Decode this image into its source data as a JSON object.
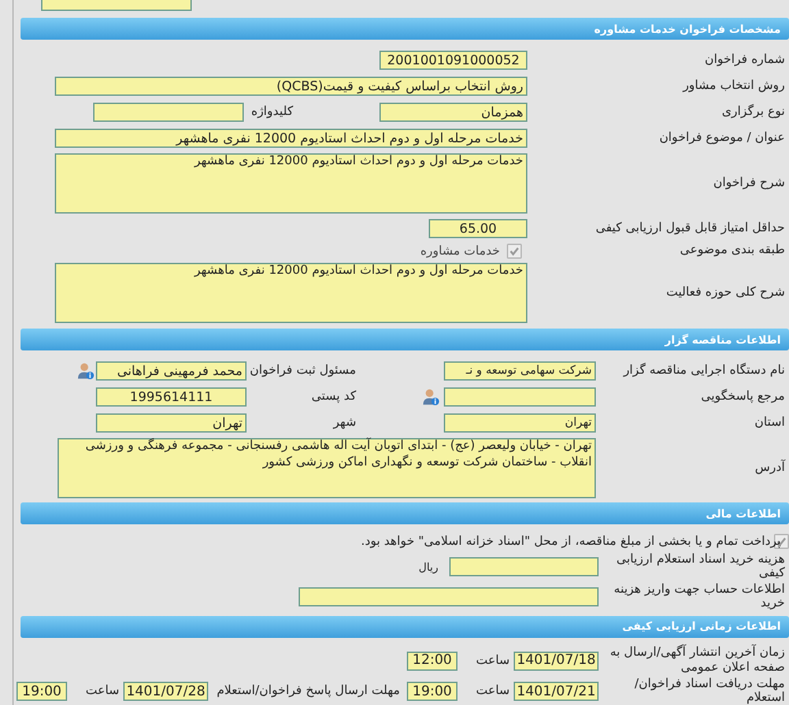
{
  "call_section": {
    "title": "مشخصات فراخوان خدمات مشاوره",
    "call_number": {
      "label": "شماره فراخوان",
      "value": "2001001091000052"
    },
    "selection_method": {
      "label": "روش انتخاب مشاور",
      "value": "روش انتخاب براساس کیفیت و قیمت(QCBS)"
    },
    "holding_type": {
      "label": "نوع برگزاری",
      "value": "همزمان"
    },
    "keyword": {
      "label": "کلیدواژه"
    },
    "subject": {
      "label": "عنوان / موضوع فراخوان",
      "value": "خدمات مرحله اول و دوم احداث استادیوم 12000 نفری ماهشهر"
    },
    "description": {
      "label": "شرح فراخوان",
      "value": "خدمات مرحله اول و دوم احداث استادیوم 12000 نفری ماهشهر"
    },
    "min_score": {
      "label": "حداقل امتیاز قابل قبول ارزیابی کیفی",
      "value": "65.00"
    },
    "category": {
      "label": "طبقه بندی موضوعی",
      "option": "خدمات مشاوره",
      "checked": true,
      "disabled": true
    },
    "activity": {
      "label": "شرح کلی حوزه فعالیت",
      "value": "خدمات مرحله اول و دوم احداث استادیوم 12000 نفری ماهشهر"
    }
  },
  "tenderer_section": {
    "title": "اطلاعات مناقصه گزار",
    "rows": [
      {
        "label": "نام دستگاه اجرایی مناقصه گزار",
        "value": "شرکت سهامی توسعه و نـ",
        "has_icon": false,
        "second_label": "مسئول ثبت فراخوان",
        "second_value": "محمد فرمهینی فراهانی",
        "second_icon": true,
        "second_center": false
      },
      {
        "label": "مرجع پاسخگویی",
        "has_icon": true,
        "second_label": "کد پستی",
        "second_value": "1995614111",
        "second_icon": false,
        "second_center": true
      },
      {
        "label": "استان",
        "value": "تهران",
        "has_icon": false,
        "second_label": "شهر",
        "second_value": "تهران",
        "second_icon": false,
        "second_center": false
      }
    ],
    "address": {
      "label": "آدرس",
      "value": "تهران - خیابان ولیعصر (عج) - ابتدای اتوبان آیت اله هاشمی رفسنجانی - مجموعه فرهنگی و ورزشی انقلاب - ساختمان شرکت توسعه و نگهداری اماکن ورزشی کشور"
    }
  },
  "finance_section": {
    "title": "اطلاعات مالی",
    "treasury": {
      "text": "پرداخت تمام و یا بخشی از مبلغ مناقصه، از محل \"اسناد خزانه اسلامی\" خواهد بود.",
      "checked": true,
      "disabled": true
    },
    "document_cost": {
      "label": "هزینه خرید اسناد استعلام ارزیابی کیفی",
      "unit": "ریال"
    },
    "account_info": {
      "label": "اطلاعات حساب جهت واریز هزینه خرید"
    }
  },
  "time_section": {
    "title": "اطلاعات زمانی ارزیابی کیفی",
    "rows": [
      {
        "label": "زمان آخرین انتشار آگهی/ارسال به صفحه اعلان عمومی",
        "date": "1401/07/18",
        "time_label": "ساعت",
        "time": "12:00"
      },
      {
        "label": "مهلت دریافت اسناد فراخوان/استعلام",
        "date": "1401/07/21",
        "time_label": "ساعت",
        "time": "19:00",
        "deadline": {
          "label": "مهلت ارسال پاسخ فراخوان/استعلام",
          "date": "1401/07/28",
          "time_label": "ساعت",
          "time": "19:00"
        }
      }
    ]
  }
}
